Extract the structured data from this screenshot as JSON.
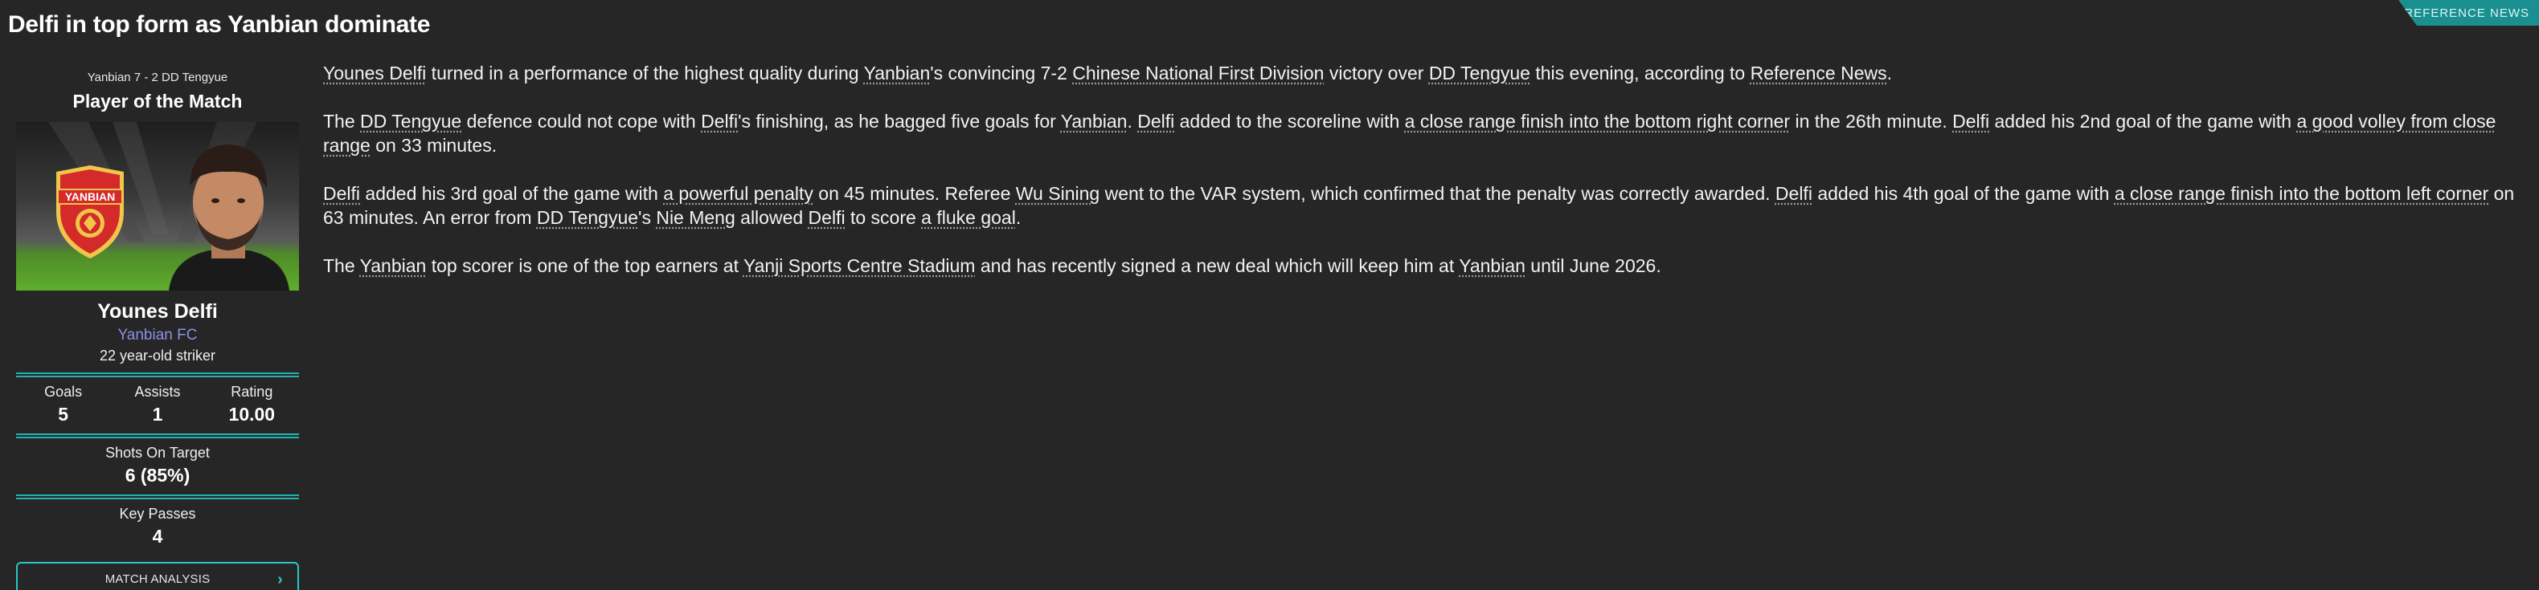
{
  "headline": "Delfi in top form as Yanbian dominate",
  "source_tab": "REFERENCE NEWS",
  "card": {
    "match_result": "Yanbian 7 - 2 DD Tengyue",
    "title": "Player of the Match",
    "crest_text": "YANBIAN",
    "player_name": "Younes Delfi",
    "club": "Yanbian FC",
    "description": "22 year-old striker",
    "stats": [
      {
        "label": "Goals",
        "value": "5"
      },
      {
        "label": "Assists",
        "value": "1"
      },
      {
        "label": "Rating",
        "value": "10.00"
      }
    ],
    "shots_on_target": {
      "label": "Shots On Target",
      "value": "6 (85%)"
    },
    "key_passes": {
      "label": "Key Passes",
      "value": "4"
    },
    "button_label": "MATCH ANALYSIS",
    "colors": {
      "accent": "#1fb3b3",
      "club": "#8f8fe8"
    }
  },
  "article": {
    "p1": {
      "player": "Younes Delfi",
      "t1": " turned in a performance of the highest quality during ",
      "club": "Yanbian",
      "t2": "'s convincing 7-2 ",
      "competition": "Chinese National First Division",
      "t3": " victory over ",
      "opponent": "DD Tengyue",
      "t4": " this evening, according to ",
      "source": "Reference News",
      "t5": "."
    },
    "p2": {
      "t0": "The ",
      "opponent": "DD Tengyue",
      "t1": " defence could not cope with ",
      "player": "Delfi",
      "t2": "'s finishing, as he bagged five goals for ",
      "club": "Yanbian",
      "t3": ". ",
      "player2": "Delfi",
      "t4": " added to the scoreline with ",
      "goal1": "a close range finish into the bottom right corner",
      "t5": " in the 26th minute. ",
      "player3": "Delfi",
      "t6": " added his 2nd goal of the game with ",
      "goal2": "a good volley from close range",
      "t7": " on 33 minutes."
    },
    "p3": {
      "player": "Delfi",
      "t1": " added his 3rd goal of the game with ",
      "goal3": "a powerful penalty",
      "t2": " on 45 minutes. Referee ",
      "referee": "Wu Sining",
      "t3": " went to the VAR system, which confirmed that the penalty was correctly awarded. ",
      "player2": "Delfi",
      "t4": " added his 4th goal of the game with ",
      "goal4": "a close range finish into the bottom left corner",
      "t5": " on 63 minutes. An error from ",
      "opponent": "DD Tengyue",
      "t6": "'s ",
      "defender": "Nie Meng",
      "t7": " allowed ",
      "player3": "Delfi",
      "t8": " to score ",
      "goal5": "a fluke goal",
      "t9": "."
    },
    "p4": {
      "t0": "The ",
      "club": "Yanbian",
      "t1": " top scorer is one of the top earners at ",
      "stadium": "Yanji Sports Centre Stadium",
      "t2": " and has recently signed a new deal which will keep him at ",
      "club2": "Yanbian",
      "t3": " until June 2026."
    }
  }
}
